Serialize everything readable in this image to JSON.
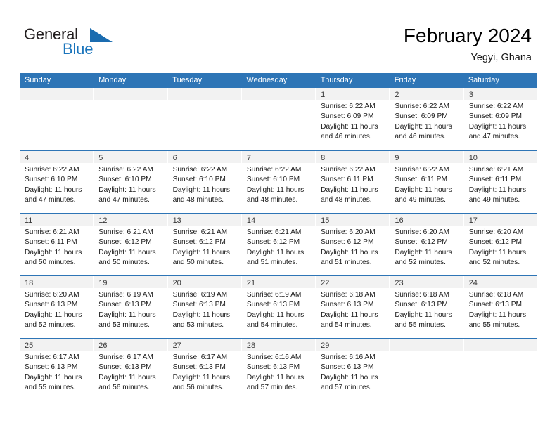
{
  "brand": {
    "name_part1": "General",
    "name_part2": "Blue",
    "flag_icon": "triangle-flag-icon"
  },
  "header": {
    "title": "February 2024",
    "location": "Yegyi, Ghana"
  },
  "colors": {
    "header_blue": "#2e75b6",
    "brand_blue": "#1b75bc",
    "band_gray": "#f2f2f2",
    "text_dark": "#1a1a1a"
  },
  "weekdays": [
    "Sunday",
    "Monday",
    "Tuesday",
    "Wednesday",
    "Thursday",
    "Friday",
    "Saturday"
  ],
  "weeks": [
    [
      {
        "day": "",
        "sunrise": "",
        "sunset": "",
        "daylight1": "",
        "daylight2": ""
      },
      {
        "day": "",
        "sunrise": "",
        "sunset": "",
        "daylight1": "",
        "daylight2": ""
      },
      {
        "day": "",
        "sunrise": "",
        "sunset": "",
        "daylight1": "",
        "daylight2": ""
      },
      {
        "day": "",
        "sunrise": "",
        "sunset": "",
        "daylight1": "",
        "daylight2": ""
      },
      {
        "day": "1",
        "sunrise": "Sunrise: 6:22 AM",
        "sunset": "Sunset: 6:09 PM",
        "daylight1": "Daylight: 11 hours",
        "daylight2": "and 46 minutes."
      },
      {
        "day": "2",
        "sunrise": "Sunrise: 6:22 AM",
        "sunset": "Sunset: 6:09 PM",
        "daylight1": "Daylight: 11 hours",
        "daylight2": "and 46 minutes."
      },
      {
        "day": "3",
        "sunrise": "Sunrise: 6:22 AM",
        "sunset": "Sunset: 6:09 PM",
        "daylight1": "Daylight: 11 hours",
        "daylight2": "and 47 minutes."
      }
    ],
    [
      {
        "day": "4",
        "sunrise": "Sunrise: 6:22 AM",
        "sunset": "Sunset: 6:10 PM",
        "daylight1": "Daylight: 11 hours",
        "daylight2": "and 47 minutes."
      },
      {
        "day": "5",
        "sunrise": "Sunrise: 6:22 AM",
        "sunset": "Sunset: 6:10 PM",
        "daylight1": "Daylight: 11 hours",
        "daylight2": "and 47 minutes."
      },
      {
        "day": "6",
        "sunrise": "Sunrise: 6:22 AM",
        "sunset": "Sunset: 6:10 PM",
        "daylight1": "Daylight: 11 hours",
        "daylight2": "and 48 minutes."
      },
      {
        "day": "7",
        "sunrise": "Sunrise: 6:22 AM",
        "sunset": "Sunset: 6:10 PM",
        "daylight1": "Daylight: 11 hours",
        "daylight2": "and 48 minutes."
      },
      {
        "day": "8",
        "sunrise": "Sunrise: 6:22 AM",
        "sunset": "Sunset: 6:11 PM",
        "daylight1": "Daylight: 11 hours",
        "daylight2": "and 48 minutes."
      },
      {
        "day": "9",
        "sunrise": "Sunrise: 6:22 AM",
        "sunset": "Sunset: 6:11 PM",
        "daylight1": "Daylight: 11 hours",
        "daylight2": "and 49 minutes."
      },
      {
        "day": "10",
        "sunrise": "Sunrise: 6:21 AM",
        "sunset": "Sunset: 6:11 PM",
        "daylight1": "Daylight: 11 hours",
        "daylight2": "and 49 minutes."
      }
    ],
    [
      {
        "day": "11",
        "sunrise": "Sunrise: 6:21 AM",
        "sunset": "Sunset: 6:11 PM",
        "daylight1": "Daylight: 11 hours",
        "daylight2": "and 50 minutes."
      },
      {
        "day": "12",
        "sunrise": "Sunrise: 6:21 AM",
        "sunset": "Sunset: 6:12 PM",
        "daylight1": "Daylight: 11 hours",
        "daylight2": "and 50 minutes."
      },
      {
        "day": "13",
        "sunrise": "Sunrise: 6:21 AM",
        "sunset": "Sunset: 6:12 PM",
        "daylight1": "Daylight: 11 hours",
        "daylight2": "and 50 minutes."
      },
      {
        "day": "14",
        "sunrise": "Sunrise: 6:21 AM",
        "sunset": "Sunset: 6:12 PM",
        "daylight1": "Daylight: 11 hours",
        "daylight2": "and 51 minutes."
      },
      {
        "day": "15",
        "sunrise": "Sunrise: 6:20 AM",
        "sunset": "Sunset: 6:12 PM",
        "daylight1": "Daylight: 11 hours",
        "daylight2": "and 51 minutes."
      },
      {
        "day": "16",
        "sunrise": "Sunrise: 6:20 AM",
        "sunset": "Sunset: 6:12 PM",
        "daylight1": "Daylight: 11 hours",
        "daylight2": "and 52 minutes."
      },
      {
        "day": "17",
        "sunrise": "Sunrise: 6:20 AM",
        "sunset": "Sunset: 6:12 PM",
        "daylight1": "Daylight: 11 hours",
        "daylight2": "and 52 minutes."
      }
    ],
    [
      {
        "day": "18",
        "sunrise": "Sunrise: 6:20 AM",
        "sunset": "Sunset: 6:13 PM",
        "daylight1": "Daylight: 11 hours",
        "daylight2": "and 52 minutes."
      },
      {
        "day": "19",
        "sunrise": "Sunrise: 6:19 AM",
        "sunset": "Sunset: 6:13 PM",
        "daylight1": "Daylight: 11 hours",
        "daylight2": "and 53 minutes."
      },
      {
        "day": "20",
        "sunrise": "Sunrise: 6:19 AM",
        "sunset": "Sunset: 6:13 PM",
        "daylight1": "Daylight: 11 hours",
        "daylight2": "and 53 minutes."
      },
      {
        "day": "21",
        "sunrise": "Sunrise: 6:19 AM",
        "sunset": "Sunset: 6:13 PM",
        "daylight1": "Daylight: 11 hours",
        "daylight2": "and 54 minutes."
      },
      {
        "day": "22",
        "sunrise": "Sunrise: 6:18 AM",
        "sunset": "Sunset: 6:13 PM",
        "daylight1": "Daylight: 11 hours",
        "daylight2": "and 54 minutes."
      },
      {
        "day": "23",
        "sunrise": "Sunrise: 6:18 AM",
        "sunset": "Sunset: 6:13 PM",
        "daylight1": "Daylight: 11 hours",
        "daylight2": "and 55 minutes."
      },
      {
        "day": "24",
        "sunrise": "Sunrise: 6:18 AM",
        "sunset": "Sunset: 6:13 PM",
        "daylight1": "Daylight: 11 hours",
        "daylight2": "and 55 minutes."
      }
    ],
    [
      {
        "day": "25",
        "sunrise": "Sunrise: 6:17 AM",
        "sunset": "Sunset: 6:13 PM",
        "daylight1": "Daylight: 11 hours",
        "daylight2": "and 55 minutes."
      },
      {
        "day": "26",
        "sunrise": "Sunrise: 6:17 AM",
        "sunset": "Sunset: 6:13 PM",
        "daylight1": "Daylight: 11 hours",
        "daylight2": "and 56 minutes."
      },
      {
        "day": "27",
        "sunrise": "Sunrise: 6:17 AM",
        "sunset": "Sunset: 6:13 PM",
        "daylight1": "Daylight: 11 hours",
        "daylight2": "and 56 minutes."
      },
      {
        "day": "28",
        "sunrise": "Sunrise: 6:16 AM",
        "sunset": "Sunset: 6:13 PM",
        "daylight1": "Daylight: 11 hours",
        "daylight2": "and 57 minutes."
      },
      {
        "day": "29",
        "sunrise": "Sunrise: 6:16 AM",
        "sunset": "Sunset: 6:13 PM",
        "daylight1": "Daylight: 11 hours",
        "daylight2": "and 57 minutes."
      },
      {
        "day": "",
        "sunrise": "",
        "sunset": "",
        "daylight1": "",
        "daylight2": ""
      },
      {
        "day": "",
        "sunrise": "",
        "sunset": "",
        "daylight1": "",
        "daylight2": ""
      }
    ]
  ]
}
